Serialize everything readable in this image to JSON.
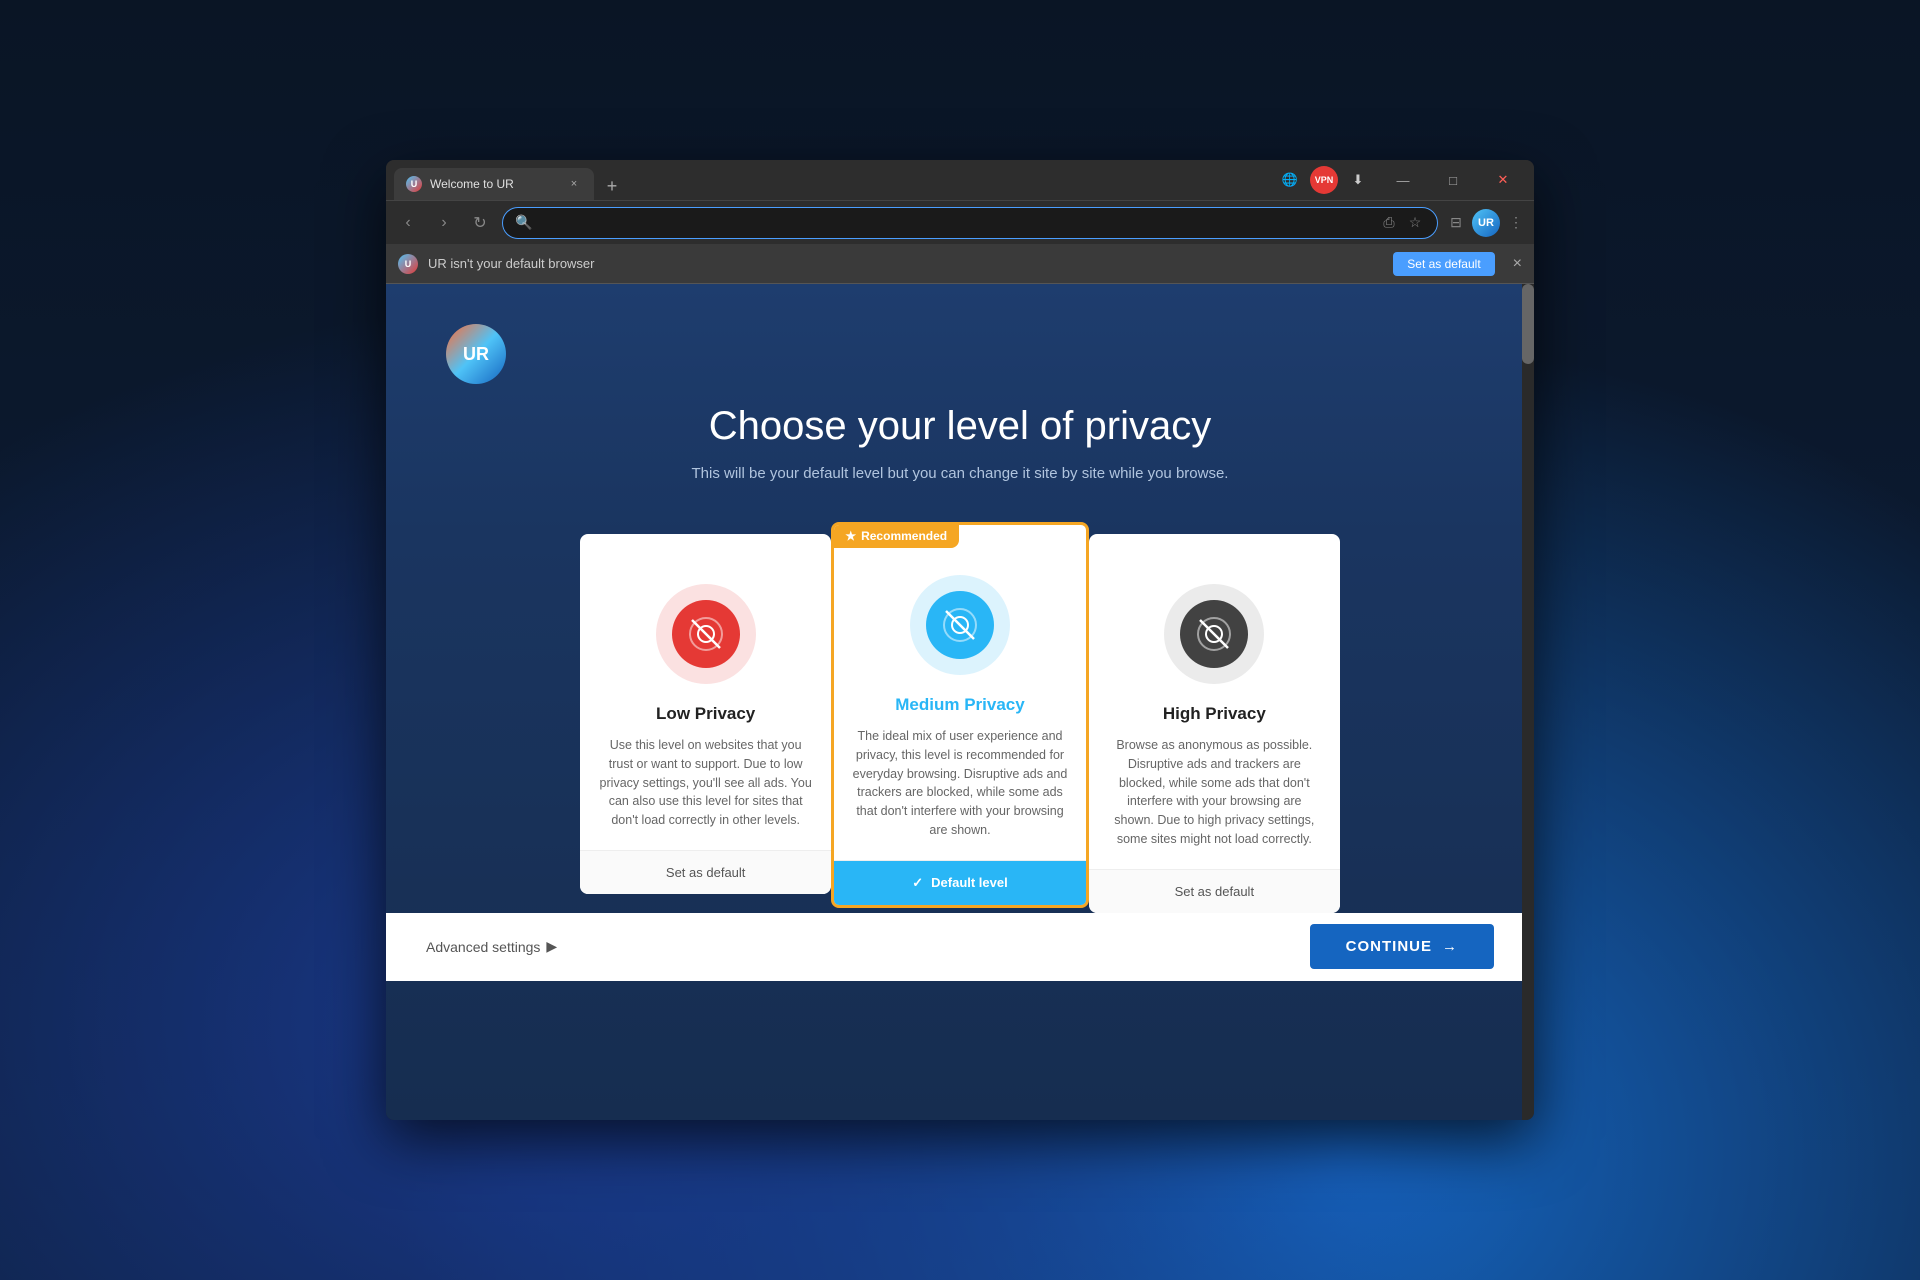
{
  "desktop": {
    "background": "dark blue"
  },
  "browser": {
    "tab": {
      "favicon_label": "U",
      "title": "Welcome to UR",
      "close_label": "×"
    },
    "new_tab_label": "+",
    "toolbar_icons": {
      "globe_icon": "🌐",
      "vpn_label": "VPN",
      "download_icon": "⬇",
      "chevron_down": "⌄",
      "minimize": "—",
      "maximize": "□",
      "close": "✕"
    },
    "nav": {
      "back_label": "‹",
      "forward_label": "›",
      "reload_label": "↻",
      "search_placeholder": "",
      "share_icon": "⎙",
      "star_icon": "☆",
      "sidebar_icon": "⊟",
      "more_icon": "⋮"
    },
    "ur_avatar_label": "UR",
    "notification": {
      "favicon_label": "U",
      "text": "UR isn't your default browser",
      "set_default_label": "Set as default",
      "close_label": "×"
    }
  },
  "page": {
    "logo_label": "UR",
    "title": "Choose your level of privacy",
    "subtitle": "This will be your default level but you can change it site by site while you browse.",
    "cards": [
      {
        "id": "low",
        "name": "Low Privacy",
        "icon_color": "red",
        "recommended": false,
        "description": "Use this level on websites that you trust or want to support. Due to low privacy settings, you'll see all ads. You can also use this level for sites that don't load correctly in other levels.",
        "footer_label": "Set as default",
        "is_default": false
      },
      {
        "id": "medium",
        "name": "Medium Privacy",
        "icon_color": "blue",
        "recommended": true,
        "recommended_label": "Recommended",
        "description": "The ideal mix of user experience and privacy, this level is recommended for everyday browsing. Disruptive ads and trackers are blocked, while some ads that don't interfere with your browsing are shown.",
        "footer_label": "Default level",
        "is_default": true
      },
      {
        "id": "high",
        "name": "High Privacy",
        "icon_color": "gray",
        "recommended": false,
        "description": "Browse as anonymous as possible. Disruptive ads and trackers are blocked, while some ads that don't interfere with your browsing are shown. Due to high privacy settings, some sites might not load correctly.",
        "footer_label": "Set as default",
        "is_default": false
      }
    ],
    "bottom_bar": {
      "advanced_settings_label": "Advanced settings",
      "advanced_settings_arrow": "▶",
      "continue_label": "CONTINUE",
      "continue_arrow": "→"
    }
  }
}
